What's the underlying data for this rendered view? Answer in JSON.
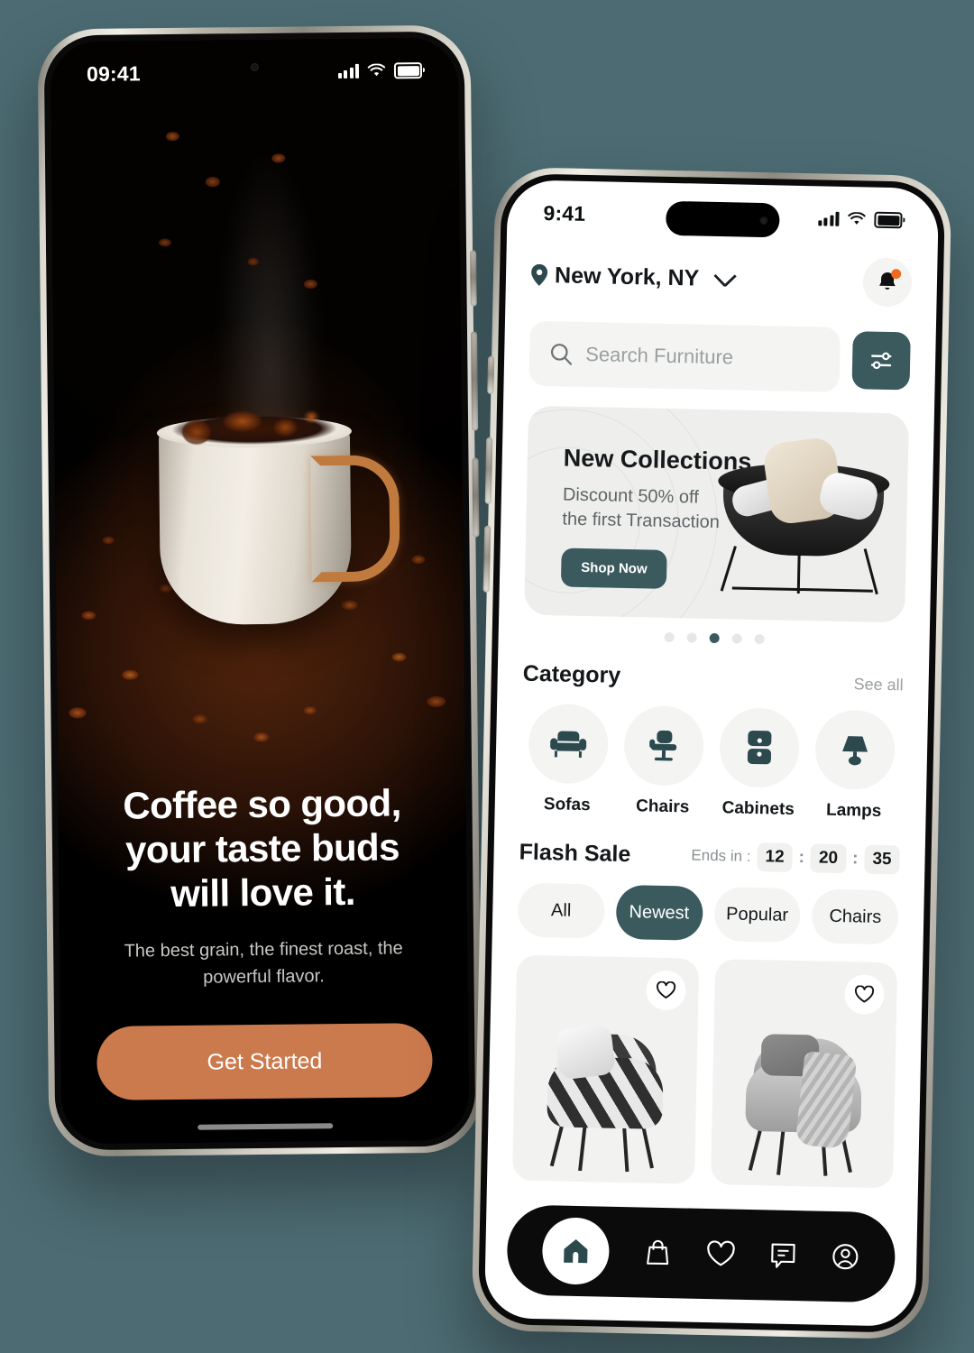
{
  "background_color": "#4c6b72",
  "colors": {
    "teal": "#3a5a5e",
    "orange": "#cb7a4d",
    "badge_orange": "#ef6a1f",
    "dark": "#0b0b0b"
  },
  "left_phone": {
    "name": "coffee-onboarding-screen",
    "status_bar": {
      "time": "09:41",
      "signal": "cellular-bars-icon",
      "wifi": "wifi-icon",
      "battery": "battery-full-icon"
    },
    "hero_image_alt": "coffee-cup-with-beans",
    "title_lines": [
      "Coffee so good,",
      "your taste buds",
      "will love it."
    ],
    "subtitle": "The best grain, the finest roast, the powerful flavor.",
    "cta_label": "Get Started"
  },
  "right_phone": {
    "name": "furniture-app-home-screen",
    "status_bar": {
      "time": "9:41",
      "signal": "cellular-bars-icon",
      "wifi": "wifi-icon",
      "battery": "battery-full-icon"
    },
    "header": {
      "location_icon": "location-pin-icon",
      "location": "New York, NY",
      "chevron": "chevron-down-icon",
      "notification_icon": "bell-icon",
      "has_badge": true
    },
    "search": {
      "placeholder": "Search Furniture",
      "icon": "search-icon",
      "filter_icon": "filter-sliders-icon"
    },
    "banner": {
      "title": "New Collections",
      "subtitle_lines": [
        "Discount 50% off",
        "the first Transaction"
      ],
      "button_label": "Shop Now",
      "image_alt": "black-rattan-lounge-chair-with-cushions"
    },
    "carousel": {
      "total": 5,
      "active_index": 2
    },
    "category_section": {
      "title": "Category",
      "see_all": "See all",
      "items": [
        {
          "label": "Sofas",
          "icon": "sofa-icon"
        },
        {
          "label": "Chairs",
          "icon": "chair-icon"
        },
        {
          "label": "Cabinets",
          "icon": "cabinet-icon"
        },
        {
          "label": "Lamps",
          "icon": "lamp-icon"
        }
      ]
    },
    "flash_sale": {
      "title": "Flash Sale",
      "ends_in_label": "Ends in :",
      "timer": {
        "hours": "12",
        "minutes": "20",
        "seconds": "35",
        "separator": ":"
      },
      "filters": [
        {
          "label": "All",
          "active": false
        },
        {
          "label": "Newest",
          "active": true
        },
        {
          "label": "Popular",
          "active": false
        },
        {
          "label": "Chairs",
          "active": false
        }
      ],
      "products": [
        {
          "image_alt": "checkered-black-white-accent-chair",
          "favorite_icon": "heart-outline-icon"
        },
        {
          "image_alt": "grey-armchair-with-throw-blanket",
          "favorite_icon": "heart-outline-icon"
        }
      ]
    },
    "tab_bar": [
      {
        "icon": "home-icon",
        "active": true
      },
      {
        "icon": "shopping-bag-icon",
        "active": false
      },
      {
        "icon": "heart-icon",
        "active": false
      },
      {
        "icon": "message-icon",
        "active": false
      },
      {
        "icon": "profile-icon",
        "active": false
      }
    ]
  }
}
